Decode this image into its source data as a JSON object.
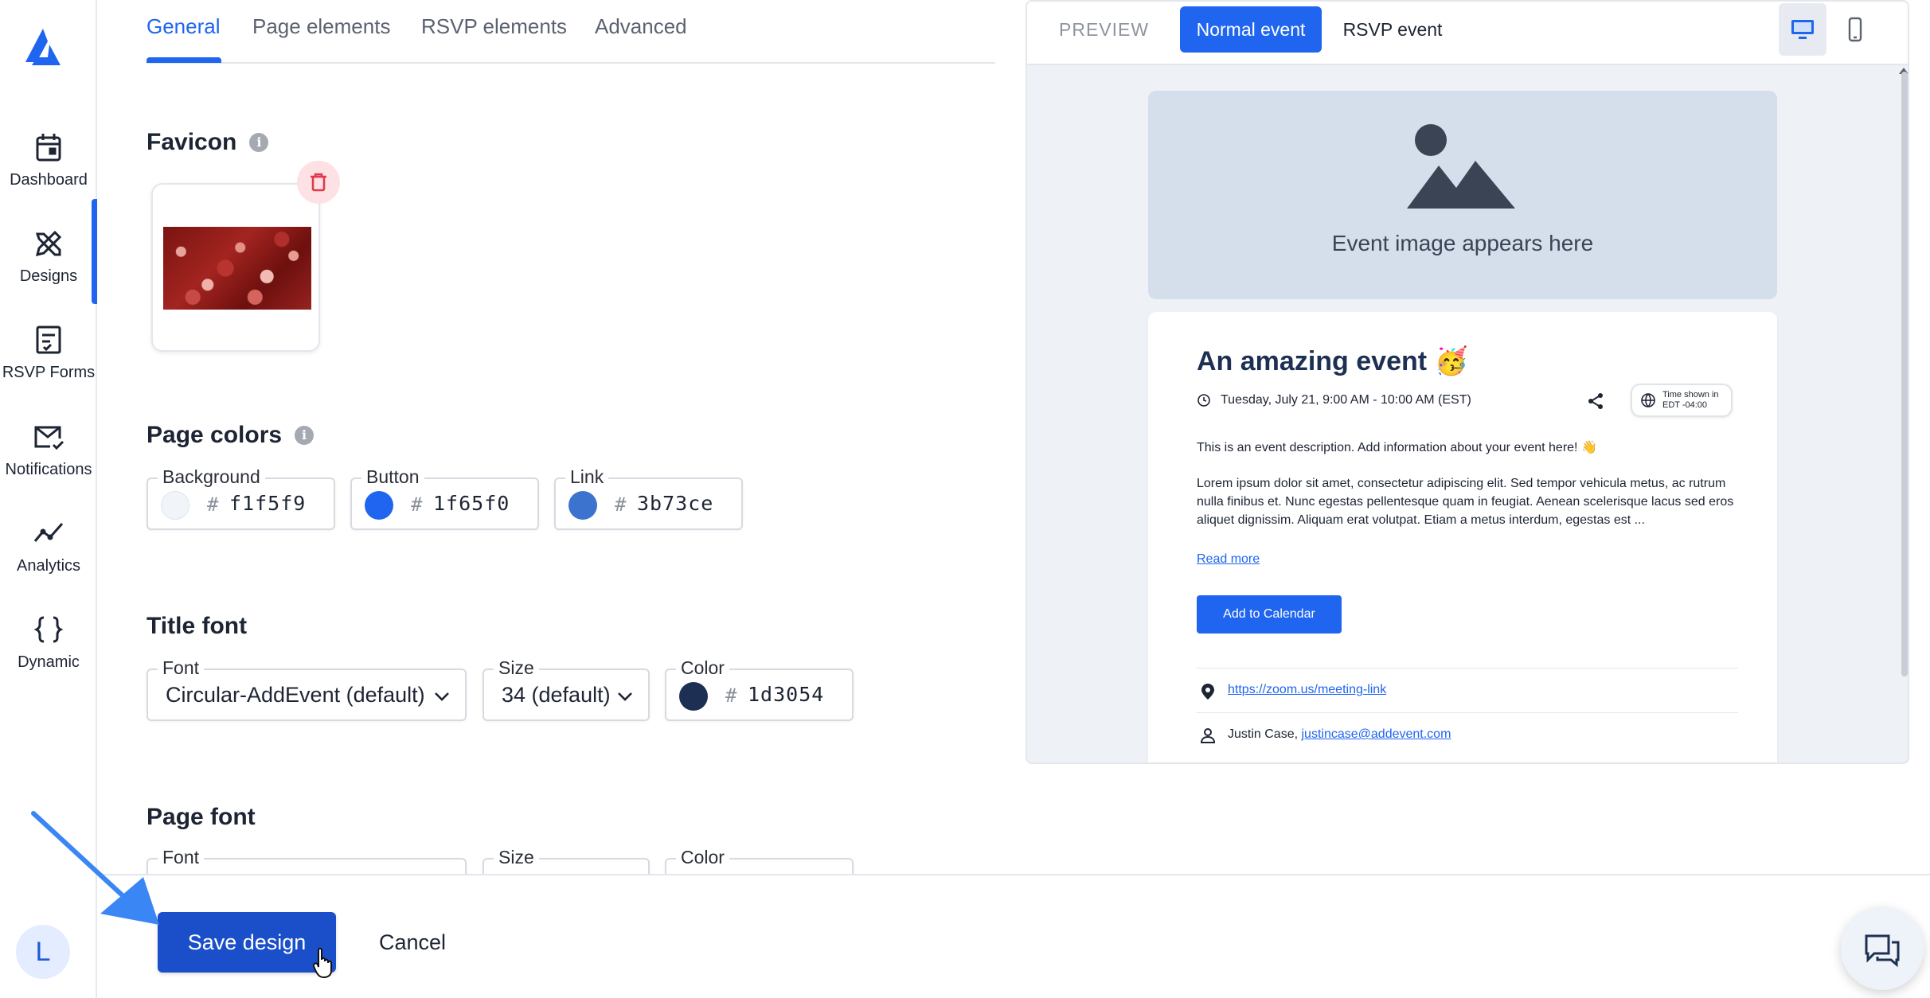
{
  "sidebar": {
    "items": [
      {
        "label": "Dashboard",
        "icon": "calendar-icon"
      },
      {
        "label": "Designs",
        "icon": "design-tools-icon",
        "active": true
      },
      {
        "label": "RSVP Forms",
        "icon": "form-icon"
      },
      {
        "label": "Notifications",
        "icon": "mail-check-icon"
      },
      {
        "label": "Analytics",
        "icon": "trend-line-icon"
      },
      {
        "label": "Dynamic",
        "icon": "curly-braces-icon"
      }
    ],
    "avatar_initial": "L"
  },
  "tabs": [
    {
      "label": "General",
      "active": true
    },
    {
      "label": "Page elements"
    },
    {
      "label": "RSVP elements"
    },
    {
      "label": "Advanced"
    }
  ],
  "favicon": {
    "heading": "Favicon"
  },
  "page_colors": {
    "heading": "Page colors",
    "fields": [
      {
        "label": "Background",
        "hex": "f1f5f9",
        "color": "#f1f5f9"
      },
      {
        "label": "Button",
        "hex": "1f65f0",
        "color": "#1f65f0"
      },
      {
        "label": "Link",
        "hex": "3b73ce",
        "color": "#3b73ce"
      }
    ]
  },
  "title_font": {
    "heading": "Title font",
    "font_label": "Font",
    "font_value": "Circular-AddEvent (default)",
    "size_label": "Size",
    "size_value": "34 (default)",
    "color_label": "Color",
    "color_hex": "1d3054",
    "color": "#1d3054"
  },
  "page_font": {
    "heading": "Page font",
    "font_label": "Font",
    "size_label": "Size",
    "color_label": "Color"
  },
  "hash_symbol": "#",
  "actions": {
    "save": "Save design",
    "cancel": "Cancel"
  },
  "preview": {
    "label": "PREVIEW",
    "modes": [
      "Normal event",
      "RSVP event"
    ],
    "image_placeholder": "Event image appears here",
    "event": {
      "title": "An amazing event 🥳",
      "datetime": "Tuesday, July 21, 9:00 AM - 10:00 AM (EST)",
      "tz_line1": "Time shown in",
      "tz_line2": "EDT -04:00",
      "description": "This is an event description. Add information about your event here! 👋",
      "lorem": "Lorem ipsum dolor sit amet, consectetur adipiscing elit. Sed tempor vehicula metus, ac rutrum nulla finibus et. Nunc egestas pellentesque quam in feugiat. Aenean scelerisque lacus sed eros aliquet dignissim. Aliquam erat volutpat. Etiam a metus interdum, egestas est ...",
      "read_more": "Read more",
      "add_to_calendar": "Add to Calendar",
      "location_link": "https://zoom.us/meeting-link",
      "organizer_name": "Justin Case,",
      "organizer_email": "justincase@addevent.com"
    }
  },
  "colors": {
    "accent": "#1f65f0",
    "save_button": "#1b4fc9",
    "annotation_arrow": "#3a86f5"
  }
}
